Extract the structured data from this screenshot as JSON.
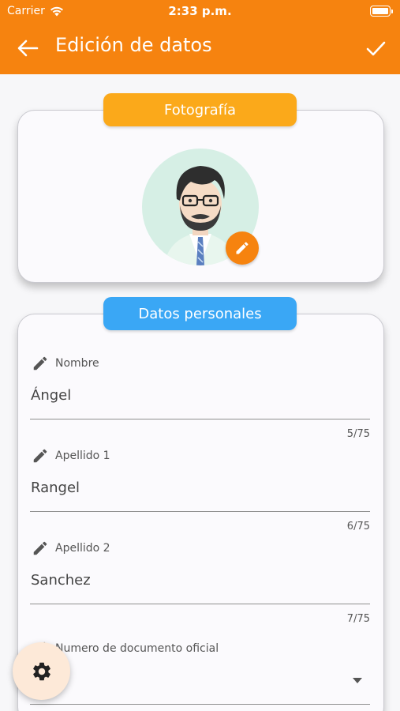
{
  "status_bar": {
    "carrier": "Carrier",
    "time": "2:33 p.m."
  },
  "app_bar": {
    "title": "Edición de datos",
    "back_icon": "arrow-left-icon",
    "confirm_icon": "check-icon",
    "background_color": "#f6830f"
  },
  "photo_section": {
    "label": "Fotografía",
    "label_color": "#fba91a",
    "edit_icon": "pencil-icon"
  },
  "personal_section": {
    "label": "Datos personales",
    "label_color": "#3aa7f5",
    "fields": [
      {
        "label": "Nombre",
        "value": "Ángel",
        "counter": "5/75"
      },
      {
        "label": "Apellido 1",
        "value": "Rangel",
        "counter": "6/75"
      },
      {
        "label": "Apellido 2",
        "value": "Sanchez",
        "counter": "7/75"
      },
      {
        "label": "Numero de documento oficial",
        "value": ""
      }
    ]
  },
  "fab": {
    "icon": "gear-icon"
  }
}
